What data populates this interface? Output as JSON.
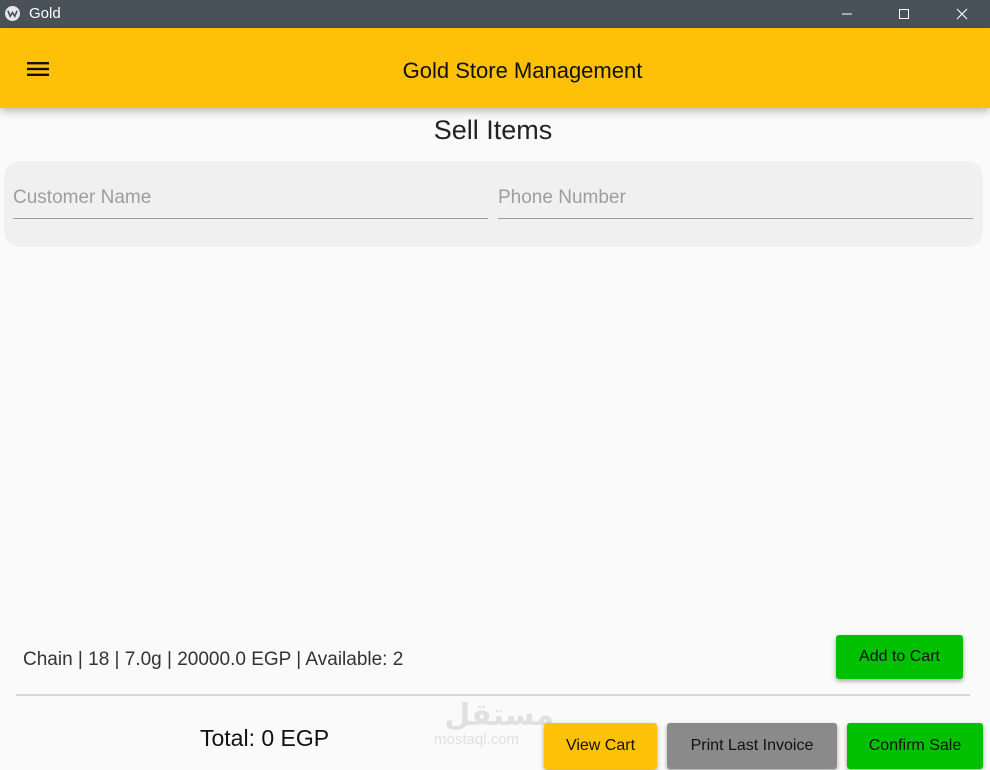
{
  "window": {
    "title": "Gold",
    "controls": [
      "minimize-icon",
      "maximize-icon",
      "close-icon"
    ]
  },
  "appbar": {
    "title": "Gold Store Management",
    "menu_icon": "hamburger-menu-icon"
  },
  "page": {
    "heading": "Sell Items"
  },
  "form": {
    "customer_name": {
      "placeholder": "Customer Name",
      "value": ""
    },
    "phone_number": {
      "placeholder": "Phone Number",
      "value": ""
    }
  },
  "product": {
    "text": "Chain | 18 | 7.0g | 20000.0 EGP | Available: 2",
    "add_label": "Add to Cart"
  },
  "footer": {
    "total": "Total: 0 EGP",
    "view_cart_label": "View Cart",
    "print_label": "Print Last Invoice",
    "confirm_label": "Confirm Sale"
  },
  "watermark": {
    "arabic": "مستقل",
    "latin": "mostaql.com"
  },
  "colors": {
    "accent": "#ffc107",
    "success": "#00c000",
    "neutral": "#8a8a8a",
    "titlebar": "#4a5259"
  }
}
